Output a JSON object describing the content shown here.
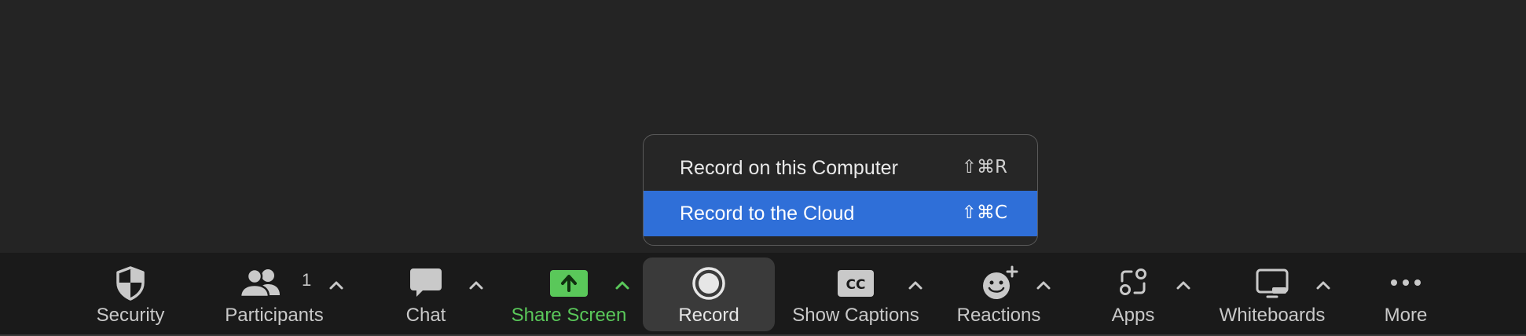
{
  "toolbar": {
    "security": {
      "label": "Security",
      "icon": "shield-icon"
    },
    "participants": {
      "label": "Participants",
      "count": "1",
      "icon": "people-icon"
    },
    "chat": {
      "label": "Chat",
      "icon": "chat-bubble-icon"
    },
    "share_screen": {
      "label": "Share Screen",
      "icon": "share-screen-icon"
    },
    "record": {
      "label": "Record",
      "icon": "record-icon"
    },
    "show_captions": {
      "label": "Show Captions",
      "icon": "cc-icon"
    },
    "reactions": {
      "label": "Reactions",
      "icon": "smiley-plus-icon"
    },
    "apps": {
      "label": "Apps",
      "icon": "apps-icon"
    },
    "whiteboards": {
      "label": "Whiteboards",
      "icon": "whiteboard-icon"
    },
    "more": {
      "label": "More",
      "icon": "more-dots-icon"
    }
  },
  "record_menu": {
    "items": [
      {
        "label": "Record on this Computer",
        "shortcut": "⇧⌘R",
        "highlighted": false
      },
      {
        "label": "Record to the Cloud",
        "shortcut": "⇧⌘C",
        "highlighted": true
      }
    ]
  },
  "colors": {
    "background": "#242424",
    "toolbar": "#1a1a1a",
    "accent_green": "#5ac85a",
    "menu_highlight": "#2f6fd8",
    "text": "#c9c9c9"
  }
}
